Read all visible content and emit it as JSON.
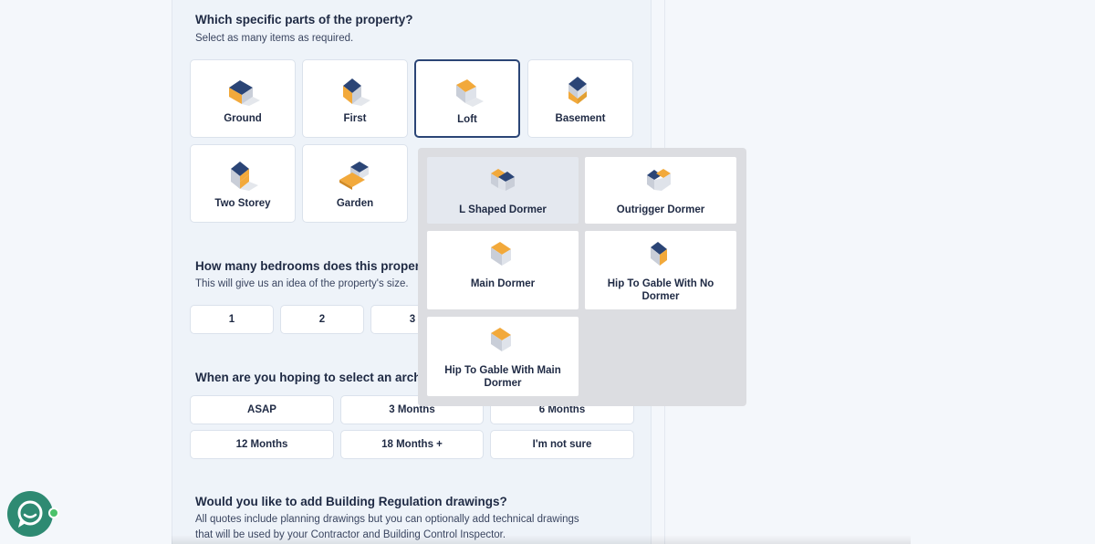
{
  "q1": {
    "title": "Which specific parts of the property?",
    "subtitle": "Select as many items as required.",
    "tiles": [
      {
        "label": "Ground",
        "icon": "house-ground-icon"
      },
      {
        "label": "First",
        "icon": "house-first-icon"
      },
      {
        "label": "Loft",
        "icon": "house-loft-icon",
        "selected": true
      },
      {
        "label": "Basement",
        "icon": "house-basement-icon"
      },
      {
        "label": "Two Storey",
        "icon": "house-two-storey-icon"
      },
      {
        "label": "Garden",
        "icon": "house-garden-icon"
      }
    ]
  },
  "q2": {
    "title": "How many bedrooms does this property",
    "subtitle": "This will give us an idea of the property's size.",
    "options": [
      "1",
      "2",
      "3"
    ]
  },
  "q3": {
    "title": "When are you hoping to select an archit",
    "options": [
      "ASAP",
      "3 Months",
      "6 Months",
      "12 Months",
      "18 Months +",
      "I'm not sure"
    ]
  },
  "q4": {
    "title": "Would you like to add Building Regulation drawings?",
    "subtitle_line1": "All quotes include planning drawings but you can optionally add technical drawings",
    "subtitle_line2": "that will be used by your Contractor and Building Control Inspector."
  },
  "popup": {
    "items": [
      {
        "label_line1": "L Shaped Dormer",
        "label_line2": "",
        "icon": "l-shaped-dormer-icon"
      },
      {
        "label_line1": "Outrigger Dormer",
        "label_line2": "",
        "icon": "outrigger-dormer-icon"
      },
      {
        "label_line1": "Main Dormer",
        "label_line2": "",
        "icon": "main-dormer-icon"
      },
      {
        "label_line1": "Hip To Gable With No",
        "label_line2": "Dormer",
        "icon": "hip-to-gable-no-dormer-icon"
      },
      {
        "label_line1": "Hip To Gable With Main",
        "label_line2": "Dormer",
        "icon": "hip-to-gable-main-dormer-icon"
      }
    ]
  },
  "colors": {
    "navy": "#2b4576",
    "accent_yellow": "#f2a93b",
    "chat_green": "#2e8a72"
  }
}
